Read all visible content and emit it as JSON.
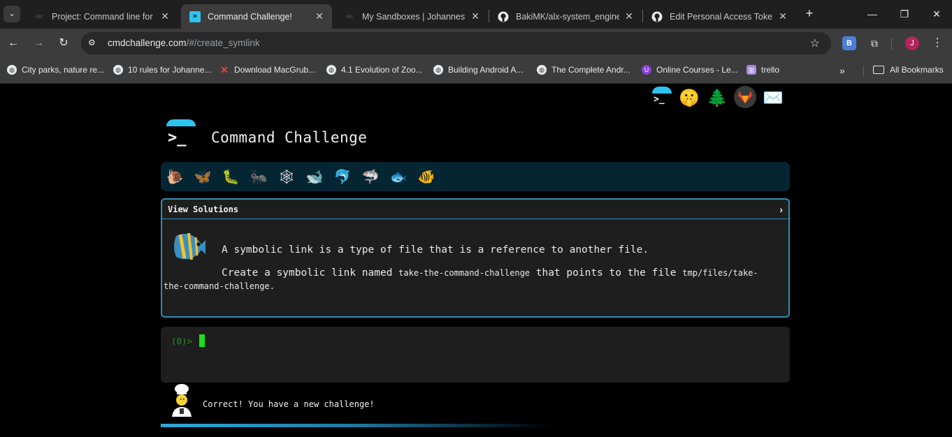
{
  "browser": {
    "tabs": [
      {
        "title": "Project: Command line for the",
        "favicon": "alx-icon"
      },
      {
        "title": "Command Challenge!",
        "favicon": "terminal-icon",
        "active": true
      },
      {
        "title": "My Sandboxes | Johannesburg",
        "favicon": "alx-icon"
      },
      {
        "title": "BakiMK/alx-system_engineering",
        "favicon": "github-icon"
      },
      {
        "title": "Edit Personal Access Token (",
        "favicon": "github-icon"
      }
    ],
    "url_host": "cmdchallenge.com",
    "url_path": "/#/create_symlink",
    "profile_initial": "J",
    "bookmarks": [
      {
        "label": "City parks, nature re...",
        "icon": "globe-icon"
      },
      {
        "label": "10 rules for Johanne...",
        "icon": "globe-icon"
      },
      {
        "label": "Download MacGrub...",
        "icon": "x-icon"
      },
      {
        "label": "4.1 Evolution of Zoo...",
        "icon": "globe-icon"
      },
      {
        "label": "Building Android A...",
        "icon": "globe-icon"
      },
      {
        "label": "The Complete Andr...",
        "icon": "globe-icon"
      },
      {
        "label": "Online Courses - Le...",
        "icon": "udemy-icon"
      },
      {
        "label": "trello",
        "icon": "trello-icon"
      }
    ],
    "all_bookmarks_label": "All Bookmarks"
  },
  "page": {
    "title": "Command Challenge",
    "header_icons": [
      "terminal-icon",
      "shushing-face-icon",
      "tree-icon",
      "gitlab-icon",
      "envelope-icon"
    ],
    "creatures": [
      "snail-icon",
      "butterfly-icon",
      "caterpillar-icon",
      "ant-icon",
      "spider-web-icon",
      "whale-icon",
      "dolphin-icon",
      "shark-icon",
      "fish-icon",
      "tropical-fish-icon"
    ],
    "challenge": {
      "header": "View Solutions",
      "line1": "A symbolic link is a type of file that is a reference to another file.",
      "line2_pre": "Create a symbolic link named ",
      "line2_code1": "take-the-command-challenge",
      "line2_mid": " that points to the file ",
      "line2_code2": "tmp/files/take-",
      "line2_wrap": "the-command-challenge",
      "line2_end": "."
    },
    "terminal": {
      "prompt": "(0)>"
    },
    "message": "Correct! You have a new challenge!"
  },
  "colors": {
    "accent": "#2fc4ef",
    "panel_border": "#2f8fb4",
    "cursor": "#19e019"
  }
}
